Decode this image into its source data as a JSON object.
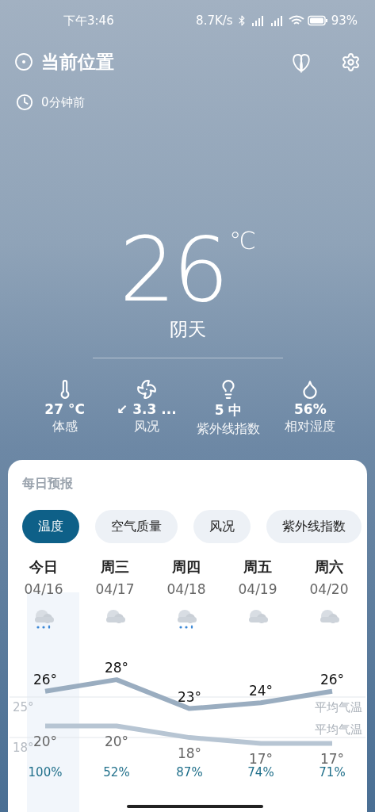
{
  "status_bar": {
    "time": "下午3:46",
    "net_speed": "8.7K/s",
    "battery": "93%"
  },
  "header": {
    "location": "当前位置",
    "updated": "0分钟前"
  },
  "current": {
    "temperature": "26",
    "unit": "℃",
    "condition": "阴天"
  },
  "metrics": [
    {
      "kind": "feels",
      "value": "27 °C",
      "label": "体感"
    },
    {
      "kind": "wind",
      "value": "↙ 3.3 ...",
      "label": "风况"
    },
    {
      "kind": "uv",
      "value": "5 中",
      "label": "紫外线指数"
    },
    {
      "kind": "humidity",
      "value": "56%",
      "label": "相对湿度"
    }
  ],
  "forecast": {
    "title": "每日预报",
    "tabs": [
      {
        "label": "温度",
        "selected": true
      },
      {
        "label": "空气质量",
        "selected": false
      },
      {
        "label": "风况",
        "selected": false
      },
      {
        "label": "紫外线指数",
        "selected": false
      }
    ],
    "days": [
      {
        "day": "今日",
        "date": "04/16",
        "kind": "rain",
        "precip": "100%",
        "selected": true
      },
      {
        "day": "周三",
        "date": "04/17",
        "kind": "cloudy",
        "precip": "52%",
        "selected": false
      },
      {
        "day": "周四",
        "date": "04/18",
        "kind": "rain",
        "precip": "87%",
        "selected": false
      },
      {
        "day": "周五",
        "date": "04/19",
        "kind": "cloudy",
        "precip": "74%",
        "selected": false
      },
      {
        "day": "周六",
        "date": "04/20",
        "kind": "cloudy",
        "precip": "71%",
        "selected": false
      }
    ],
    "chart_data": {
      "type": "line",
      "series": [
        {
          "color": "#9aadc0",
          "values": [
            26,
            28,
            23,
            24,
            26
          ]
        },
        {
          "color": "#b7c5d3",
          "values": [
            20,
            20,
            18,
            17,
            17
          ]
        }
      ],
      "value_labels": [
        [
          "26°",
          "28°",
          "23°",
          "24°",
          "26°"
        ],
        [
          "20°",
          "20°",
          "18°",
          "17°",
          "17°"
        ]
      ],
      "ylim": [
        10.2,
        33.5
      ],
      "yticks": [
        {
          "value": 25,
          "label": "25°"
        },
        {
          "value": 18,
          "label": "18°"
        }
      ],
      "annotations": [
        "平均气温",
        "平均气温"
      ]
    }
  }
}
